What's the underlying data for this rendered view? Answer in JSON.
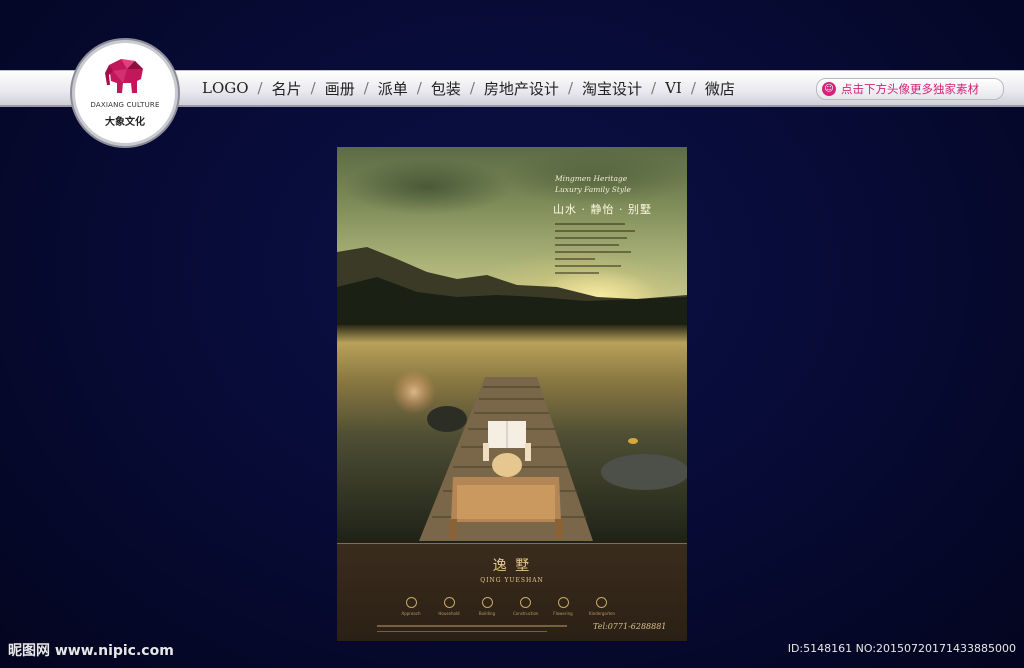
{
  "logo": {
    "brand_en": "DAXIANG CULTURE",
    "brand_cn": "大象文化",
    "icon": "elephant-icon",
    "color": "#c2185b"
  },
  "nav": {
    "items": [
      "LOGO",
      "名片",
      "画册",
      "派单",
      "包装",
      "房地产设计",
      "淘宝设计",
      "VI",
      "微店"
    ],
    "separator": "/"
  },
  "promo": {
    "label": "点击下方头像更多独家素材",
    "icon": "avatar-icon",
    "color": "#d2247a"
  },
  "poster": {
    "tagline_en_1": "Mingmen Heritage",
    "tagline_en_2": "Luxury Family Style",
    "tagline_cn": "山水 · 静怡 · 别墅",
    "brand_cn": "逸 墅",
    "brand_en": "QING YUESHAN",
    "features": [
      "Approach",
      "Household",
      "Building",
      "Construction",
      "Flowering",
      "Kindergarten"
    ],
    "tel": "Tel:0771-6288881"
  },
  "watermark": {
    "left": "昵图网 www.nipic.com",
    "right": "ID:5148161 NO:20150720171433885000"
  }
}
